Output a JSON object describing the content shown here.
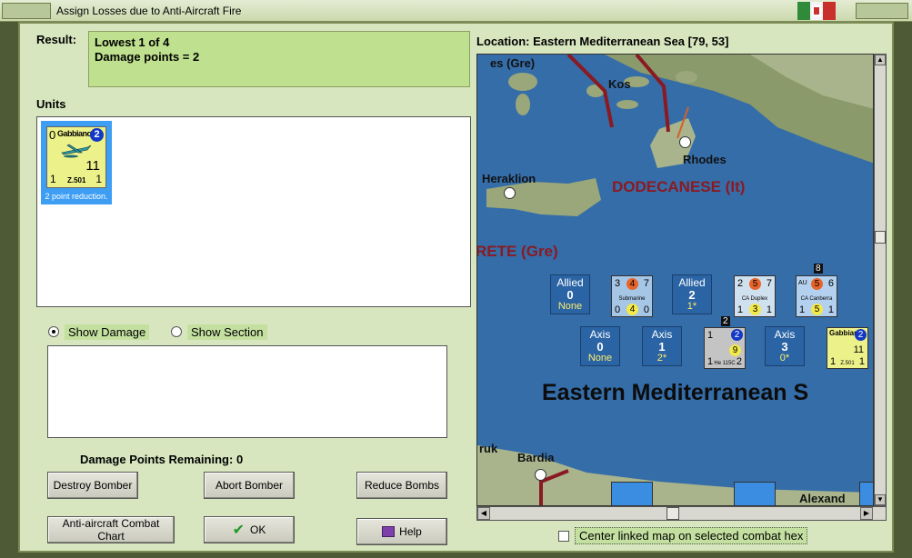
{
  "window": {
    "title": "Assign Losses due to Anti-Aircraft Fire"
  },
  "result": {
    "label": "Result:",
    "line1": "Lowest 1 of 4",
    "line2": "Damage points = 2"
  },
  "units": {
    "label": "Units",
    "items": [
      {
        "name": "Gabbiano",
        "top_left": "0",
        "circle": "2",
        "strength": "11",
        "bottom_left": "1",
        "bottom_right": "1",
        "type": "Z.501",
        "caption": "2 point reduction."
      }
    ]
  },
  "view_options": {
    "show_damage": "Show Damage",
    "show_section": "Show Section",
    "selected": "show_damage"
  },
  "damage_points": {
    "label": "Damage Points Remaining:",
    "value": "0"
  },
  "buttons": {
    "destroy": "Destroy Bomber",
    "abort": "Abort Bomber",
    "reduce": "Reduce Bombs",
    "aa_chart": "Anti-aircraft Combat Chart",
    "ok": "OK",
    "help": "Help"
  },
  "location": {
    "label": "Location:",
    "value": "Eastern Mediterranean Sea [79, 53]"
  },
  "map": {
    "places": {
      "gre": "es (Gre)",
      "kos": "Kos",
      "rhodes": "Rhodes",
      "heraklion": "Heraklion",
      "crete": "RETE (Gre)",
      "dodecanese": "DODECANESE (It)",
      "sea": "Eastern Mediterranean S",
      "tobruk": "ruk",
      "bardia": "Bardia",
      "alexandria": "Alexand"
    },
    "allied_boxes": [
      {
        "side": "Allied",
        "value": "0",
        "sub": "None"
      },
      {
        "side": "Allied",
        "value": "2",
        "sub": "1*"
      }
    ],
    "axis_boxes": [
      {
        "side": "Axis",
        "value": "0",
        "sub": "None"
      },
      {
        "side": "Axis",
        "value": "1",
        "sub": "2*"
      },
      {
        "side": "Axis",
        "value": "3",
        "sub": "0*"
      }
    ],
    "counters": {
      "submarine": {
        "label": "Submarine",
        "tl": "3",
        "top": "4",
        "tr": "7",
        "bl": "0",
        "mid": "4",
        "br": "0"
      },
      "ca_duplex": {
        "label": "CA Duplex",
        "tl": "2",
        "top": "5",
        "tr": "7",
        "bl": "1",
        "mid": "3",
        "br": "1"
      },
      "ca_canberra": {
        "label": "CA Canberra",
        "tl": "AU",
        "top": "5",
        "tr": "6",
        "bl": "1",
        "mid": "5",
        "br": "1",
        "stack": "8"
      },
      "he115": {
        "label": "He 115C",
        "tl": "1",
        "circle": "2",
        "strength": "9",
        "bl": "1",
        "br": "2",
        "stack": "2"
      },
      "gabbiano_map": {
        "label": "Z.501",
        "name": "Gabbiano",
        "circle": "2",
        "strength": "11",
        "bl": "1",
        "br": "1"
      }
    }
  },
  "center_option": {
    "label": "Center linked map on selected combat hex",
    "checked": false
  },
  "colors": {
    "frame": "#4e5a35",
    "panel": "#d8e6bf",
    "result_bg": "#bfe08e",
    "sea": "#356da8",
    "region_text": "#8a1a22"
  }
}
